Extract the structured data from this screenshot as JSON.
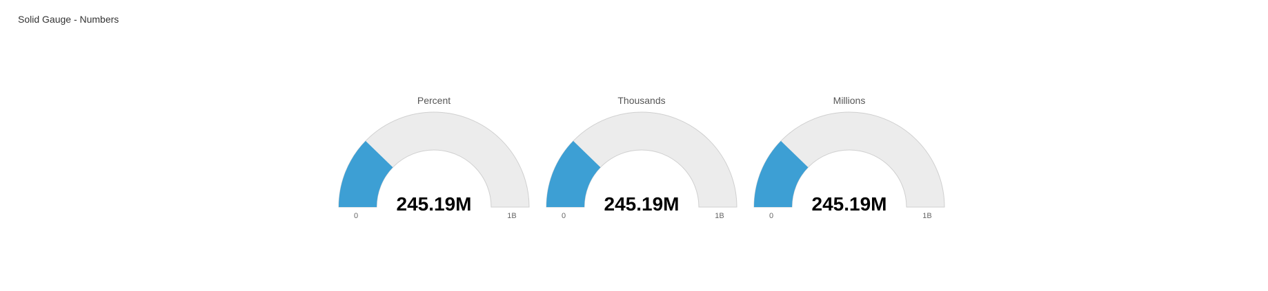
{
  "page": {
    "title": "Solid Gauge - Numbers"
  },
  "colors": {
    "fill": "#3d9fd4",
    "track": "#ececec",
    "track_stroke": "#cfcfcf"
  },
  "chart_data": [
    {
      "type": "solid-gauge",
      "title": "Percent",
      "value": 245190000,
      "value_label": "245.19M",
      "min": 0,
      "max": 1000000000,
      "min_label": "0",
      "max_label": "1B"
    },
    {
      "type": "solid-gauge",
      "title": "Thousands",
      "value": 245190000,
      "value_label": "245.19M",
      "min": 0,
      "max": 1000000000,
      "min_label": "0",
      "max_label": "1B"
    },
    {
      "type": "solid-gauge",
      "title": "Millions",
      "value": 245190000,
      "value_label": "245.19M",
      "min": 0,
      "max": 1000000000,
      "min_label": "0",
      "max_label": "1B"
    }
  ]
}
